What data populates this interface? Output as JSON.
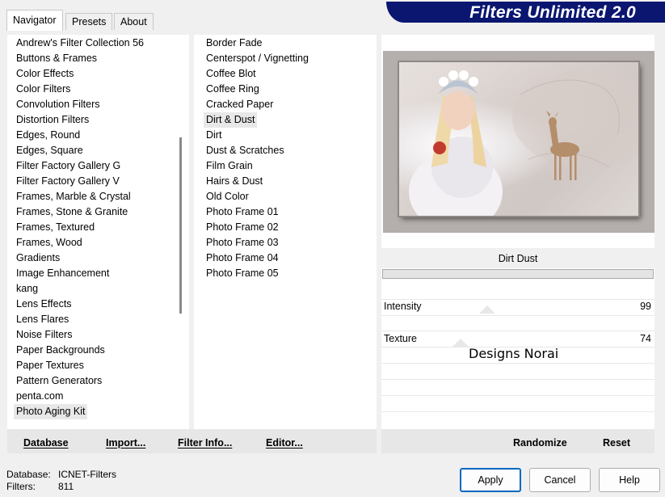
{
  "tabs": [
    "Navigator",
    "Presets",
    "About"
  ],
  "brand": "Filters Unlimited 2.0",
  "categories": {
    "items": [
      "Andrew's Filter Collection 56",
      "Buttons & Frames",
      "Color Effects",
      "Color Filters",
      "Convolution Filters",
      "Distortion Filters",
      "Edges, Round",
      "Edges, Square",
      "Filter Factory Gallery G",
      "Filter Factory Gallery V",
      "Frames, Marble & Crystal",
      "Frames, Stone & Granite",
      "Frames, Textured",
      "Frames, Wood",
      "Gradients",
      "Image Enhancement",
      "kang",
      "Lens Effects",
      "Lens Flares",
      "Noise Filters",
      "Paper Backgrounds",
      "Paper Textures",
      "Pattern Generators",
      "penta.com",
      "Photo Aging Kit"
    ],
    "selected": "Photo Aging Kit"
  },
  "filters": {
    "items": [
      "Border Fade",
      "Centerspot / Vignetting",
      "Coffee Blot",
      "Coffee Ring",
      "Cracked Paper",
      "Dirt & Dust",
      "Dirt",
      "Dust & Scratches",
      "Film Grain",
      "Hairs & Dust",
      "Old Color",
      "Photo Frame 01",
      "Photo Frame 02",
      "Photo Frame 03",
      "Photo Frame 04",
      "Photo Frame 05"
    ],
    "selected": "Dirt & Dust"
  },
  "left_buttons": {
    "database": "Database",
    "import": "Import...",
    "filter_info": "Filter Info...",
    "editor": "Editor..."
  },
  "filter_title": "Dirt  Dust",
  "params": [
    {
      "label": "Intensity",
      "value": "99"
    },
    {
      "label": "Texture",
      "value": "74"
    }
  ],
  "watermark": "Designs Norai",
  "right_buttons": {
    "randomize": "Randomize",
    "reset": "Reset"
  },
  "status": {
    "database_label": "Database:",
    "database_value": "ICNET-Filters",
    "filters_label": "Filters:",
    "filters_value": "811"
  },
  "dialog_buttons": {
    "apply": "Apply",
    "cancel": "Cancel",
    "help": "Help"
  }
}
